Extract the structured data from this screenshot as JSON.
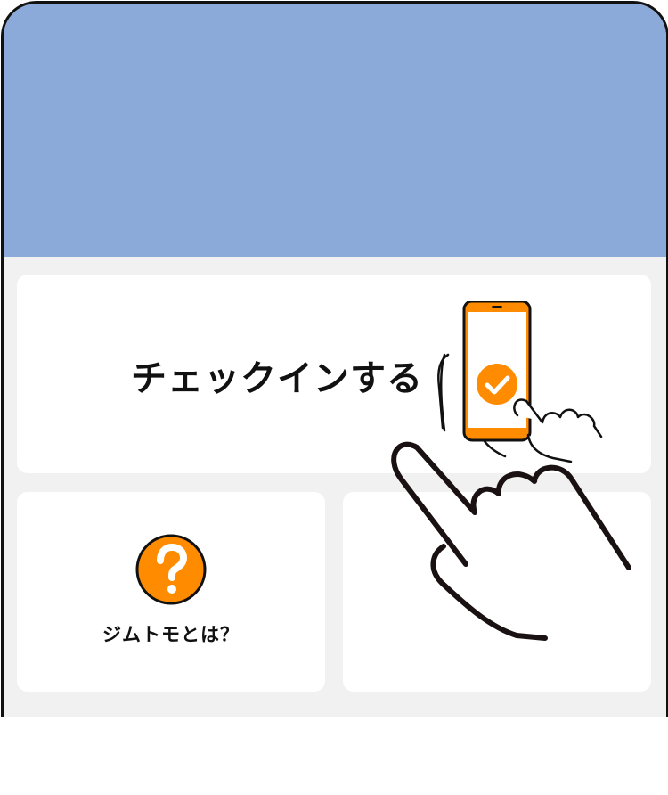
{
  "colors": {
    "header_banner": "#8caad9",
    "background": "#f1f1f1",
    "card": "#ffffff",
    "accent_orange": "#ff8c00",
    "outline": "#111111"
  },
  "checkin": {
    "label": "チェックインする",
    "illustration": "phone-checkmark-icon"
  },
  "about": {
    "label": "ジムトモとは？",
    "icon": "question-icon"
  },
  "overlay": {
    "icon": "pointing-hand-icon"
  }
}
